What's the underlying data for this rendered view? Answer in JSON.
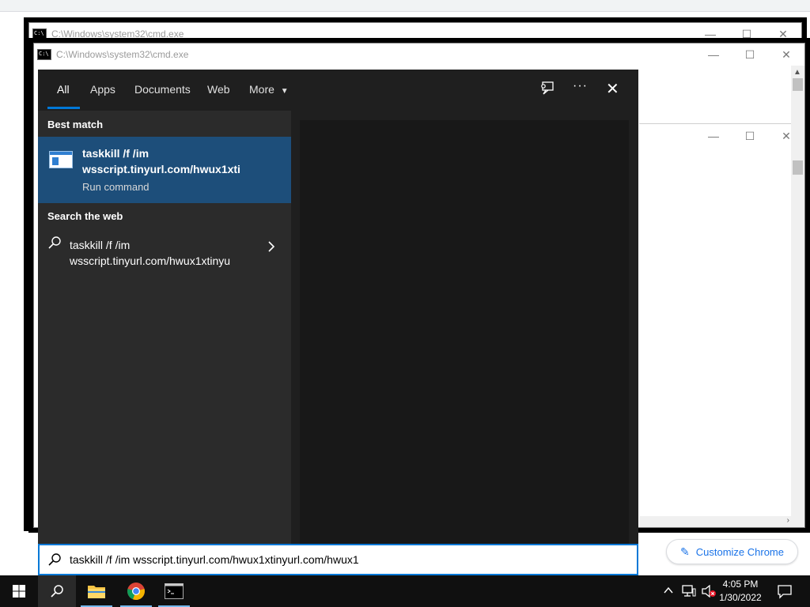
{
  "background": {
    "customize_chrome_label": "Customize Chrome"
  },
  "cmd_windows": [
    {
      "title": "C:\\Windows\\system32\\cmd.exe"
    },
    {
      "title": "C:\\Windows\\system32\\cmd.exe"
    }
  ],
  "search": {
    "tabs": [
      "All",
      "Apps",
      "Documents",
      "Web",
      "More"
    ],
    "active_tab": "All",
    "best_match_heading": "Best match",
    "best_match": {
      "title": "taskkill /f /im wsscript.tinyurl.com/hwux1xti",
      "subtitle": "Run command"
    },
    "search_web_heading": "Search the web",
    "web_result": "taskkill /f /im wsscript.tinyurl.com/hwux1xtinyu",
    "query": "taskkill /f /im wsscript.tinyurl.com/hwux1xtinyurl.com/hwux1"
  },
  "taskbar": {
    "time": "4:05 PM",
    "date": "1/30/2022"
  },
  "colors": {
    "accent": "#0078d7",
    "selected_result": "#1d4e7a",
    "panel_bg": "#2b2b2b",
    "taskbar_bg": "#101010"
  }
}
